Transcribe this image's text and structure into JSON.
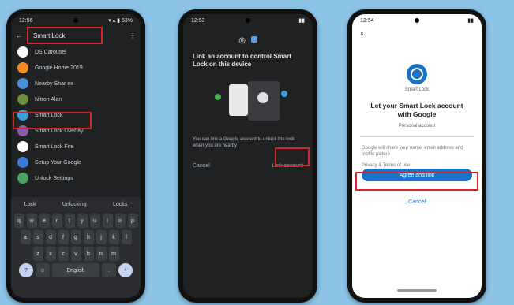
{
  "phone1": {
    "status_time": "12:56",
    "status_icons": "▾ ▴ ▮ 63%",
    "search_query": "Smart Lock",
    "apps": [
      {
        "name": "DS Carousel",
        "color": "#ffffff"
      },
      {
        "name": "Google Home 2019",
        "color": "#f28b22"
      },
      {
        "name": "Nearby Shar ex",
        "color": "#4a8fd8"
      },
      {
        "name": "Nitron Alan",
        "color": "#6a8f3b"
      },
      {
        "name": "Smart Lock",
        "color": "#3aa0d8"
      },
      {
        "name": "Smart Lock Overlay",
        "color": "#8a5ab0"
      },
      {
        "name": "Smart Lock Fire",
        "color": "#ffffff"
      },
      {
        "name": "Setup Your Google",
        "color": "#3a7bd5"
      },
      {
        "name": "Unlock Settings",
        "color": "#4aa35d"
      }
    ],
    "keyboard": {
      "suggestions": [
        "Lock",
        "Unlocking",
        "Locks"
      ],
      "row1": [
        "q",
        "w",
        "e",
        "r",
        "t",
        "y",
        "u",
        "i",
        "o",
        "p"
      ],
      "row2": [
        "a",
        "s",
        "d",
        "f",
        "g",
        "h",
        "j",
        "k",
        "l"
      ],
      "row3": [
        "z",
        "x",
        "c",
        "v",
        "b",
        "n",
        "m"
      ],
      "space_label": "English"
    }
  },
  "phone2": {
    "status_time": "12:53",
    "title": "Link an account to control Smart Lock on this device",
    "body": "You can link a Google account to unlock the lock when you are nearby",
    "cancel_label": "Cancel",
    "link_label": "Link account"
  },
  "phone3": {
    "status_time": "12:54",
    "app_label": "Smart Lock",
    "title": "Let your Smart Lock account with Google",
    "subtitle": "Personal account",
    "info1": "Google will share your name, email address and profile picture",
    "info2": "Privacy & Terms of use",
    "primary_button": "Agree and link",
    "secondary_link": "Cancel"
  }
}
